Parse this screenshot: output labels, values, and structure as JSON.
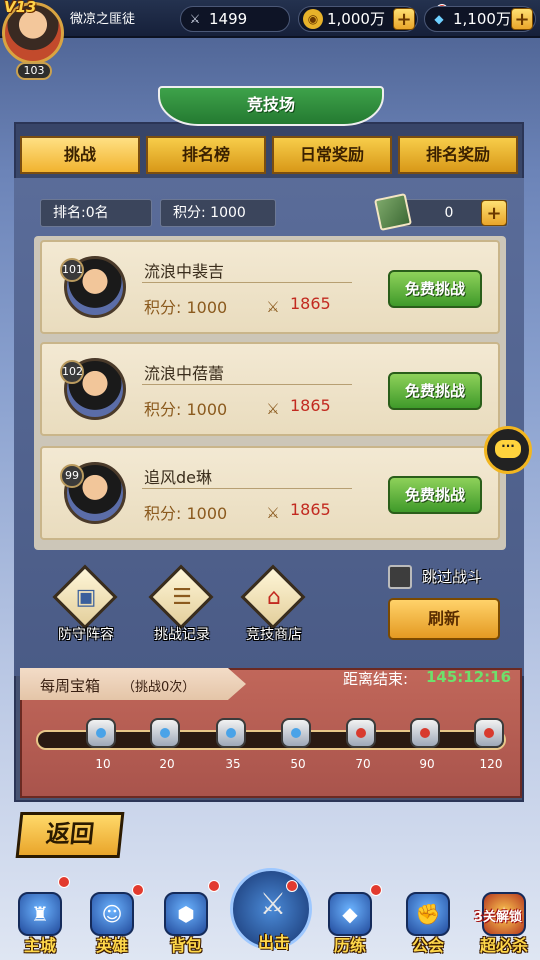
{
  "player": {
    "vip": "V13",
    "name": "微凉之匪徒",
    "level": "103"
  },
  "resources": {
    "power": {
      "icon": "crossed-swords-icon",
      "value": "1499"
    },
    "gold": {
      "icon": "coin-icon",
      "value": "1,000万"
    },
    "diamond": {
      "icon": "diamond-icon",
      "value": "1,100万"
    }
  },
  "page_title": "竞技场",
  "tabs": [
    {
      "label": "挑战",
      "active": true
    },
    {
      "label": "排名榜",
      "active": false
    },
    {
      "label": "日常奖励",
      "active": false
    },
    {
      "label": "排名奖励",
      "active": false
    }
  ],
  "stats": {
    "rank": "排名:0名",
    "score": "积分: 1000",
    "tickets": "0"
  },
  "opponents": [
    {
      "level": "101",
      "name": "流浪中裴吉",
      "score": "积分: 1000",
      "power": "1865",
      "button": "免费挑战"
    },
    {
      "level": "102",
      "name": "流浪中蓓蕾",
      "score": "积分: 1000",
      "power": "1865",
      "button": "免费挑战"
    },
    {
      "level": "99",
      "name": "追风de琳",
      "score": "积分: 1000",
      "power": "1865",
      "button": "免费挑战"
    }
  ],
  "features": [
    {
      "label": "防守阵容",
      "icon": "defense-formation-icon",
      "glyph": "▣"
    },
    {
      "label": "挑战记录",
      "icon": "scroll-icon",
      "glyph": "☰"
    },
    {
      "label": "竞技商店",
      "icon": "shop-icon",
      "glyph": "⌂"
    }
  ],
  "skip_battle": {
    "label": "跳过战斗",
    "checked": false
  },
  "refresh_label": "刷新",
  "weekly": {
    "title": "每周宝箱",
    "subtitle": "（挑战0次）",
    "countdown_label": "距离结束:",
    "countdown": "145:12:16",
    "progress": 0,
    "milestones": [
      "10",
      "20",
      "35",
      "50",
      "70",
      "90",
      "120"
    ]
  },
  "back_label": "返回",
  "nav": [
    {
      "label": "主城",
      "icon": "city-icon",
      "glyph": "♜",
      "dot": true
    },
    {
      "label": "英雄",
      "icon": "hero-icon",
      "glyph": "☺",
      "dot": true
    },
    {
      "label": "背包",
      "icon": "bag-icon",
      "glyph": "⬢",
      "dot": true
    },
    {
      "label": "出击",
      "icon": "swords-icon",
      "glyph": "⚔",
      "dot": true
    },
    {
      "label": "历练",
      "icon": "training-icon",
      "glyph": "◆",
      "dot": true
    },
    {
      "label": "公会",
      "icon": "guild-icon",
      "glyph": "✊",
      "dot": false
    },
    {
      "label": "超必杀",
      "icon": "ultimate-icon",
      "glyph": "✦",
      "dot": false
    }
  ],
  "unlock_tag": "3关解锁"
}
